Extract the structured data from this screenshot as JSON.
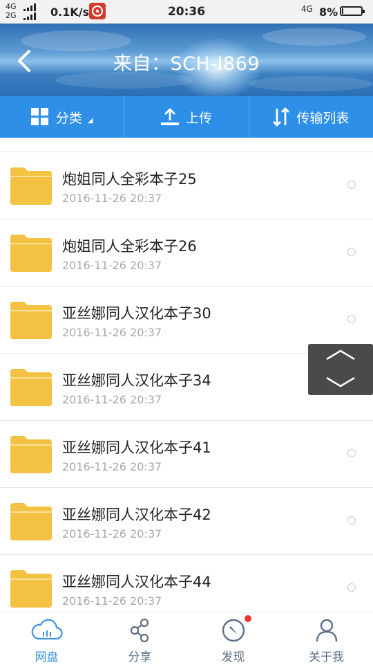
{
  "status_bar": {
    "net_top": "4G",
    "net_bottom": "2G",
    "speed": "0.1K/s",
    "time": "20:36",
    "net_right": "4G",
    "battery": "8%"
  },
  "header": {
    "title": "来自：SCH-I869"
  },
  "toolbar": {
    "category_label": "分类",
    "upload_label": "上传",
    "transfer_label": "传输列表"
  },
  "files": [
    {
      "name": "炮姐同人全彩本子25",
      "time": "2016-11-26  20:37"
    },
    {
      "name": "炮姐同人全彩本子26",
      "time": "2016-11-26  20:37"
    },
    {
      "name": "亚丝娜同人汉化本子30",
      "time": "2016-11-26  20:37"
    },
    {
      "name": "亚丝娜同人汉化本子34",
      "time": "2016-11-26  20:37"
    },
    {
      "name": "亚丝娜同人汉化本子41",
      "time": "2016-11-26  20:37"
    },
    {
      "name": "亚丝娜同人汉化本子42",
      "time": "2016-11-26  20:37"
    },
    {
      "name": "亚丝娜同人汉化本子44",
      "time": "2016-11-26  20:37"
    }
  ],
  "bottom_nav": {
    "items": [
      {
        "label": "网盘",
        "icon": "cloud-icon",
        "active": true
      },
      {
        "label": "分享",
        "icon": "share-icon",
        "active": false
      },
      {
        "label": "发现",
        "icon": "compass-icon",
        "active": false,
        "badge_dot": true
      },
      {
        "label": "关于我",
        "icon": "user-icon",
        "active": false
      }
    ]
  },
  "colors": {
    "toolbar": "#2d8fe8",
    "folder": "#f3c243",
    "active_nav": "#3b92e6",
    "badge": "#e7392c"
  }
}
